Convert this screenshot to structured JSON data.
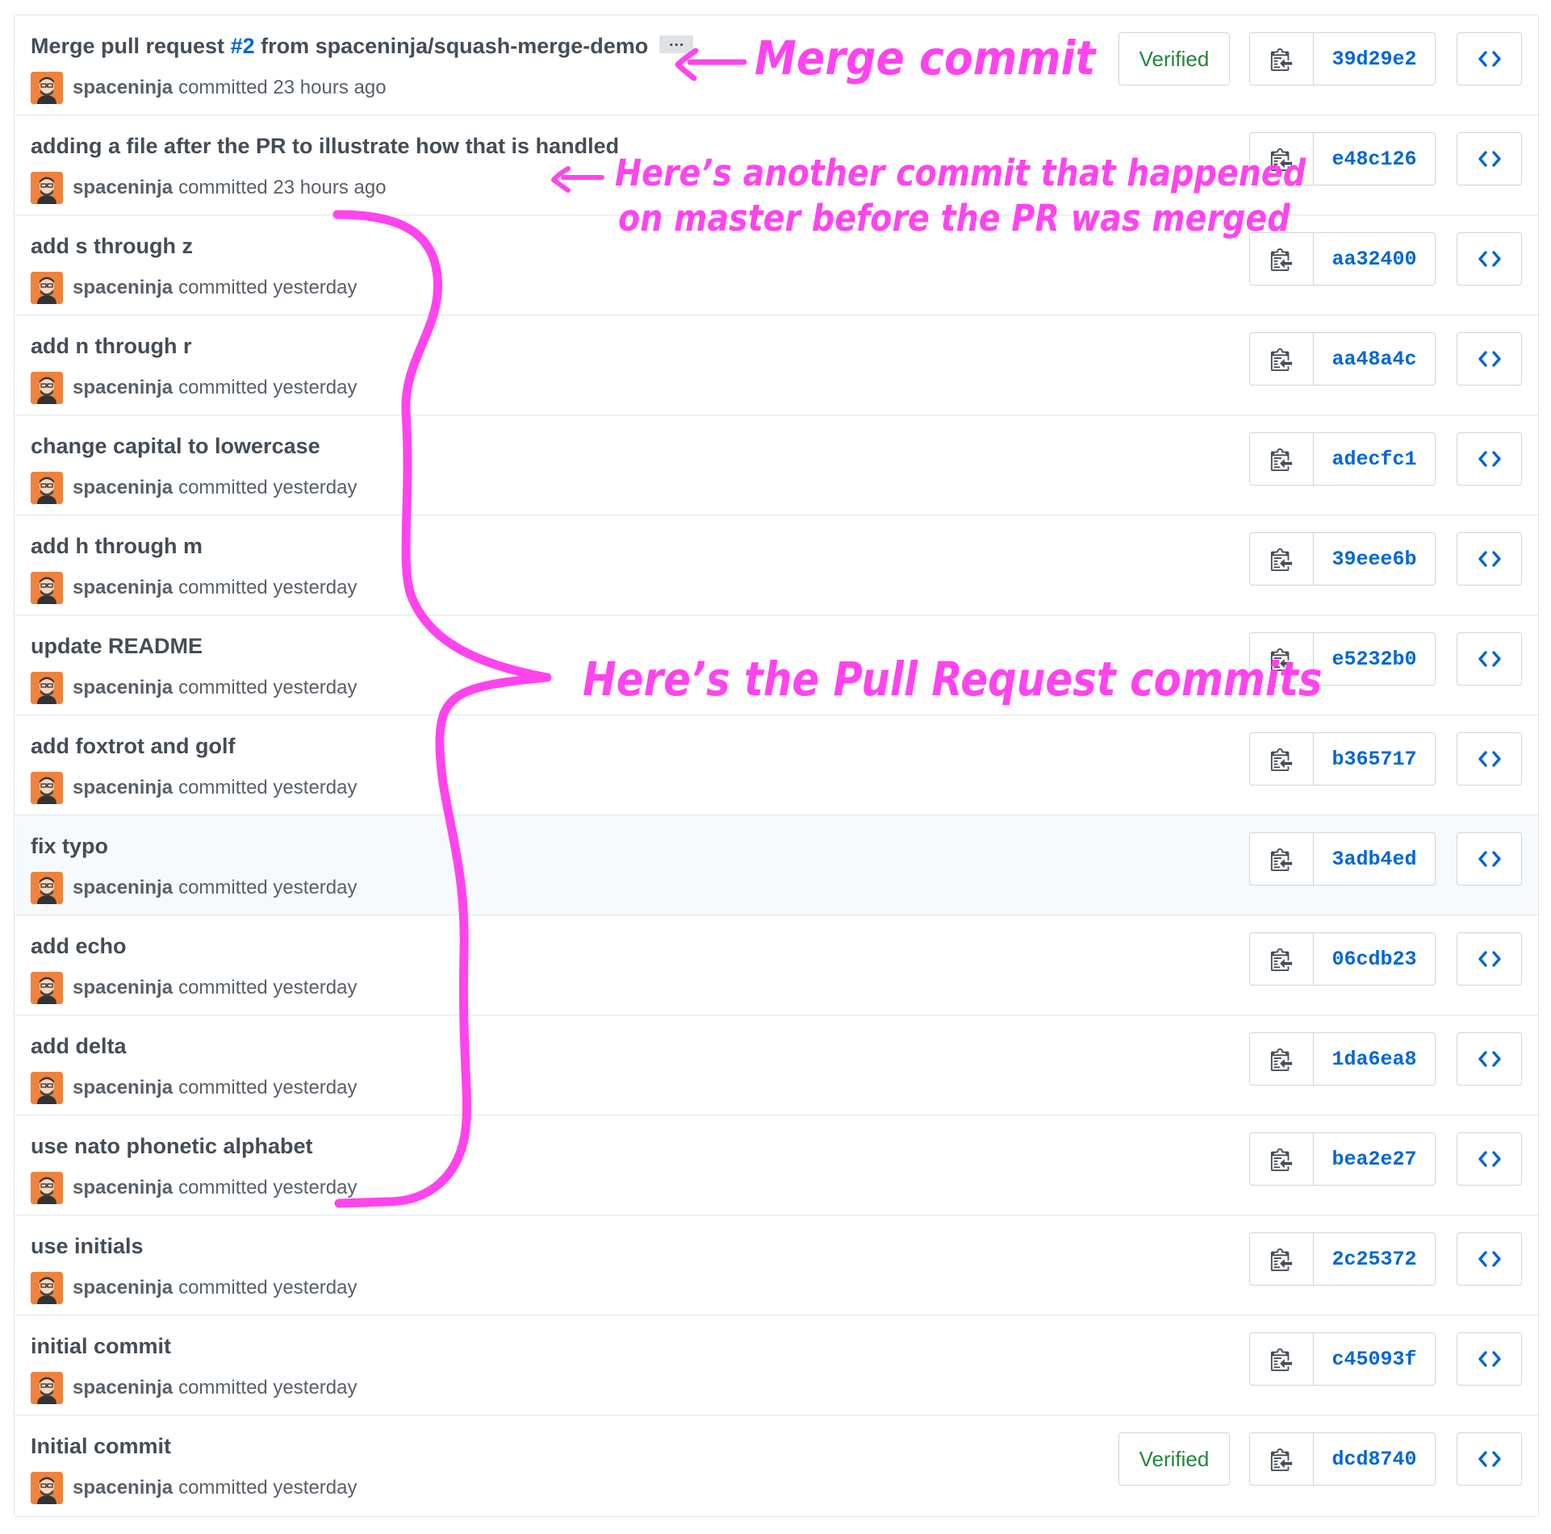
{
  "commits": [
    {
      "title": "Merge pull request ",
      "pr": "#2",
      "title_suffix": " from spaceninja/squash-merge-demo",
      "ellipsis": "…",
      "author": "spaceninja",
      "time": "committed 23 hours ago",
      "verified": "Verified",
      "sha": "39d29e2"
    },
    {
      "title": "adding a file after the PR to illustrate how that is handled",
      "author": "spaceninja",
      "time": "committed 23 hours ago",
      "sha": "e48c126"
    },
    {
      "title": "add s through z",
      "author": "spaceninja",
      "time": "committed yesterday",
      "sha": "aa32400"
    },
    {
      "title": "add n through r",
      "author": "spaceninja",
      "time": "committed yesterday",
      "sha": "aa48a4c"
    },
    {
      "title": "change capital to lowercase",
      "author": "spaceninja",
      "time": "committed yesterday",
      "sha": "adecfc1"
    },
    {
      "title": "add h through m",
      "author": "spaceninja",
      "time": "committed yesterday",
      "sha": "39eee6b"
    },
    {
      "title": "update README",
      "author": "spaceninja",
      "time": "committed yesterday",
      "sha": "e5232b0"
    },
    {
      "title": "add foxtrot and golf",
      "author": "spaceninja",
      "time": "committed yesterday",
      "sha": "b365717"
    },
    {
      "title": "fix typo",
      "author": "spaceninja",
      "time": "committed yesterday",
      "sha": "3adb4ed"
    },
    {
      "title": "add echo",
      "author": "spaceninja",
      "time": "committed yesterday",
      "sha": "06cdb23"
    },
    {
      "title": "add delta",
      "author": "spaceninja",
      "time": "committed yesterday",
      "sha": "1da6ea8"
    },
    {
      "title": "use nato phonetic alphabet",
      "author": "spaceninja",
      "time": "committed yesterday",
      "sha": "bea2e27"
    },
    {
      "title": "use initials",
      "author": "spaceninja",
      "time": "committed yesterday",
      "sha": "2c25372"
    },
    {
      "title": "initial commit",
      "author": "spaceninja",
      "time": "committed yesterday",
      "sha": "c45093f"
    },
    {
      "title": "Initial commit",
      "author": "spaceninja",
      "time": "committed yesterday",
      "verified": "Verified",
      "sha": "dcd8740"
    }
  ],
  "annotations": {
    "merge": "Merge commit",
    "another_line1": "Here’s another commit that happened",
    "another_line2": "on master before the PR was merged",
    "pr_commits": "Here’s the Pull Request commits"
  },
  "colors": {
    "annotation": "#ff44ee",
    "link": "#0366d6",
    "verified": "#22863a",
    "border": "#e1e4e8",
    "highlight_row": "#f6fafd"
  },
  "icons": {
    "copy": "clippy-icon",
    "browse": "code-icon",
    "avatar": "user-avatar"
  }
}
